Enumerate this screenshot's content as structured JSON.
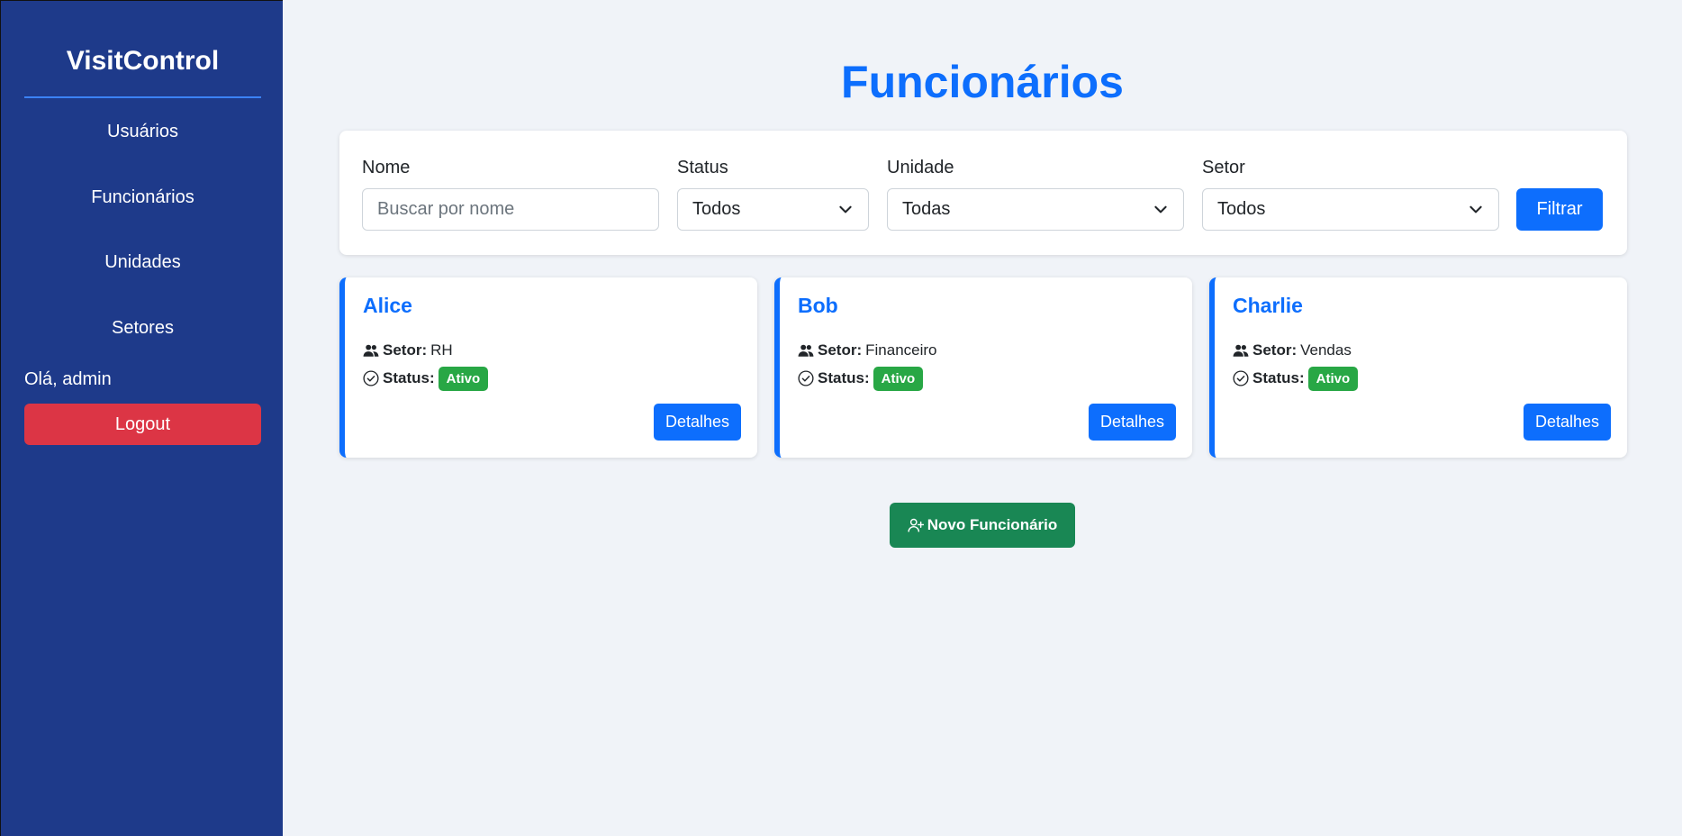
{
  "sidebar": {
    "brand": "VisitControl",
    "items": [
      {
        "label": "Usuários"
      },
      {
        "label": "Funcionários"
      },
      {
        "label": "Unidades"
      },
      {
        "label": "Setores"
      }
    ],
    "greeting": "Olá, admin",
    "logout_label": "Logout"
  },
  "main": {
    "title": "Funcionários"
  },
  "filters": {
    "nome_label": "Nome",
    "nome_placeholder": "Buscar por nome",
    "nome_value": "",
    "status_label": "Status",
    "status_value": "Todos",
    "unidade_label": "Unidade",
    "unidade_value": "Todas",
    "setor_label": "Setor",
    "setor_value": "Todos",
    "submit_label": "Filtrar"
  },
  "cards": [
    {
      "name": "Alice",
      "setor_label": "Setor:",
      "setor": "RH",
      "status_label": "Status:",
      "status": "Ativo",
      "details_label": "Detalhes"
    },
    {
      "name": "Bob",
      "setor_label": "Setor:",
      "setor": "Financeiro",
      "status_label": "Status:",
      "status": "Ativo",
      "details_label": "Detalhes"
    },
    {
      "name": "Charlie",
      "setor_label": "Setor:",
      "setor": "Vendas",
      "status_label": "Status:",
      "status": "Ativo",
      "details_label": "Detalhes"
    }
  ],
  "new_button_label": "Novo Funcionário",
  "icons": {
    "setor": "people-icon",
    "status": "check-circle-icon",
    "new": "person-plus-icon",
    "select": "chevron-down-icon"
  },
  "colors": {
    "sidebar_bg": "#1e3a8a",
    "primary": "#0d6efd",
    "danger": "#dc3545",
    "success": "#198754",
    "badge": "#28a745"
  }
}
